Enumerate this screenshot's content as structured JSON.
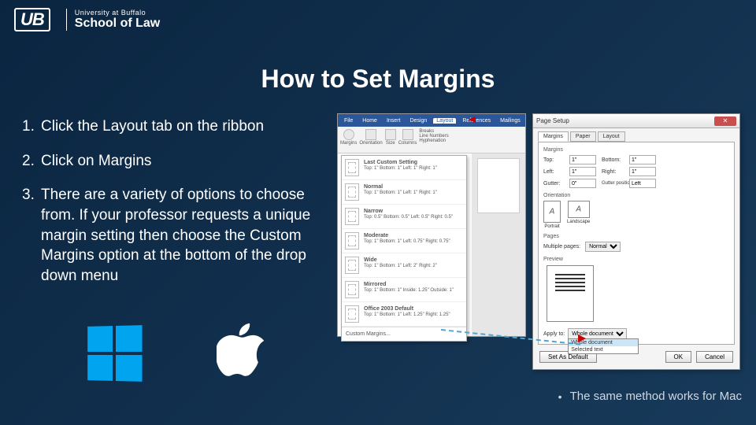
{
  "logo": {
    "mark": "UB",
    "small": "University at Buffalo",
    "big": "School of Law"
  },
  "title": "How to Set Margins",
  "steps": [
    {
      "num": "1.",
      "text": "Click the Layout tab on the ribbon"
    },
    {
      "num": "2.",
      "text": "Click on Margins"
    },
    {
      "num": "3.",
      "text": "There are a variety of options to choose from.  If your professor requests a unique margin setting then choose the Custom Margins option at the bottom of the drop down menu"
    }
  ],
  "ribbon": {
    "tabs": [
      "File",
      "Home",
      "Insert",
      "Design",
      "Layout",
      "References",
      "Mailings"
    ]
  },
  "toolbar": {
    "margins": "Margins",
    "orientation": "Orientation",
    "size": "Size",
    "columns": "Columns",
    "breaks": "Breaks",
    "line_numbers": "Line Numbers",
    "hyphenation": "Hyphenation"
  },
  "dropdown": {
    "items": [
      {
        "name": "Last Custom Setting",
        "detail": "Top: 1\"   Bottom: 1\"   Left: 1\"   Right: 1\""
      },
      {
        "name": "Normal",
        "detail": "Top: 1\"   Bottom: 1\"   Left: 1\"   Right: 1\""
      },
      {
        "name": "Narrow",
        "detail": "Top: 0.5\"  Bottom: 0.5\"  Left: 0.5\"  Right: 0.5\""
      },
      {
        "name": "Moderate",
        "detail": "Top: 1\"   Bottom: 1\"   Left: 0.75\"  Right: 0.75\""
      },
      {
        "name": "Wide",
        "detail": "Top: 1\"   Bottom: 1\"   Left: 2\"   Right: 2\""
      },
      {
        "name": "Mirrored",
        "detail": "Top: 1\"   Bottom: 1\"   Inside: 1.25\"  Outside: 1\""
      },
      {
        "name": "Office 2003 Default",
        "detail": "Top: 1\"   Bottom: 1\"   Left: 1.25\"  Right: 1.25\""
      }
    ],
    "footer": "Custom Margins..."
  },
  "dialog": {
    "title": "Page Setup",
    "tabs": [
      "Margins",
      "Paper",
      "Layout"
    ],
    "margins_section": "Margins",
    "fields": {
      "top_label": "Top:",
      "top": "1\"",
      "bottom_label": "Bottom:",
      "bottom": "1\"",
      "left_label": "Left:",
      "left": "1\"",
      "right_label": "Right:",
      "right": "1\"",
      "gutter_label": "Gutter:",
      "gutter": "0\"",
      "gutter_pos_label": "Gutter position:",
      "gutter_pos": "Left"
    },
    "orientation_label": "Orientation",
    "orientation": {
      "portrait": "Portrait",
      "landscape": "Landscape"
    },
    "pages_label": "Pages",
    "multiple_pages_label": "Multiple pages:",
    "multiple_pages": "Normal",
    "preview_label": "Preview",
    "apply_label": "Apply to:",
    "apply_value": "Whole document",
    "apply_options": [
      "Whole document",
      "Selected text"
    ],
    "set_default": "Set As Default",
    "ok": "OK",
    "cancel": "Cancel"
  },
  "footer_note": "The same method works for Mac"
}
